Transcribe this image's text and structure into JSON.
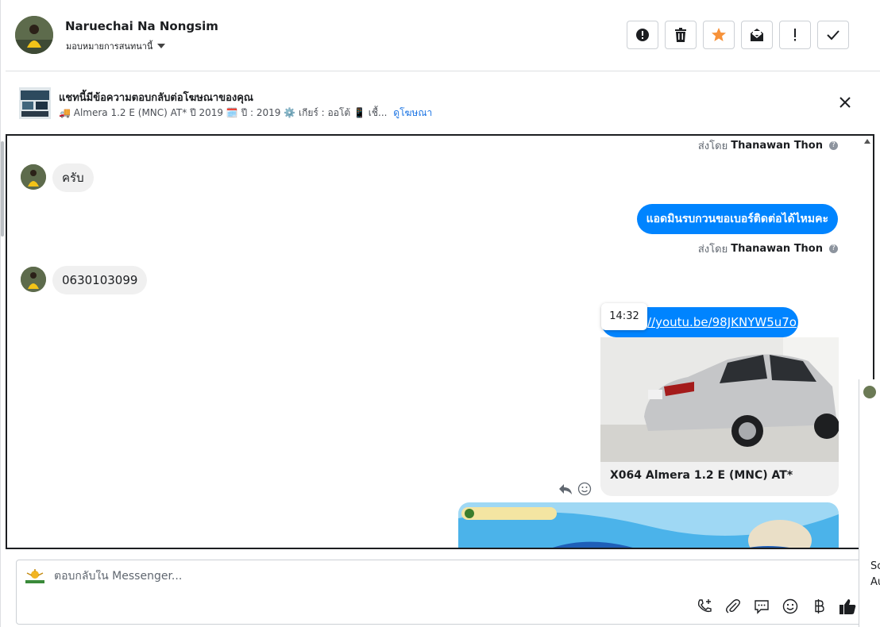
{
  "contact": {
    "name": "Naruechai Na Nongsim",
    "assign_label": "มอบหมายการสนทนานี้"
  },
  "ad_banner": {
    "title": "แชทนี้มีข้อความตอบกลับต่อโฆษณาของคุณ",
    "description": "🚚 Almera 1.2 E (MNC) AT* ปี 2019 🗓️ ปี : 2019 ⚙️ เกียร์ : ออโต้ 📱 เชื้...",
    "link_label": "ดูโฆษณา"
  },
  "messages": {
    "sent_by_prefix": "ส่งโดย",
    "agent_name": "Thanawan Thon",
    "incoming_1": "ครับ",
    "outgoing_1": "แอดมินรบกวนขอเบอร์ติดต่อได้ไหมคะ",
    "incoming_2": "0630103099",
    "link_text": "//youtu.be/98JKNYW5u7o",
    "timestamp": "14:32",
    "card_title": "X064 Almera 1.2 E (MNC) AT*"
  },
  "composer": {
    "placeholder": "ตอบกลับใน Messenger..."
  },
  "side_fragment": {
    "line1": "Sc",
    "line2": "Au"
  },
  "colors": {
    "accent_blue": "#0084ff",
    "link_blue": "#1b74e4",
    "star_orange": "#f7923a"
  }
}
